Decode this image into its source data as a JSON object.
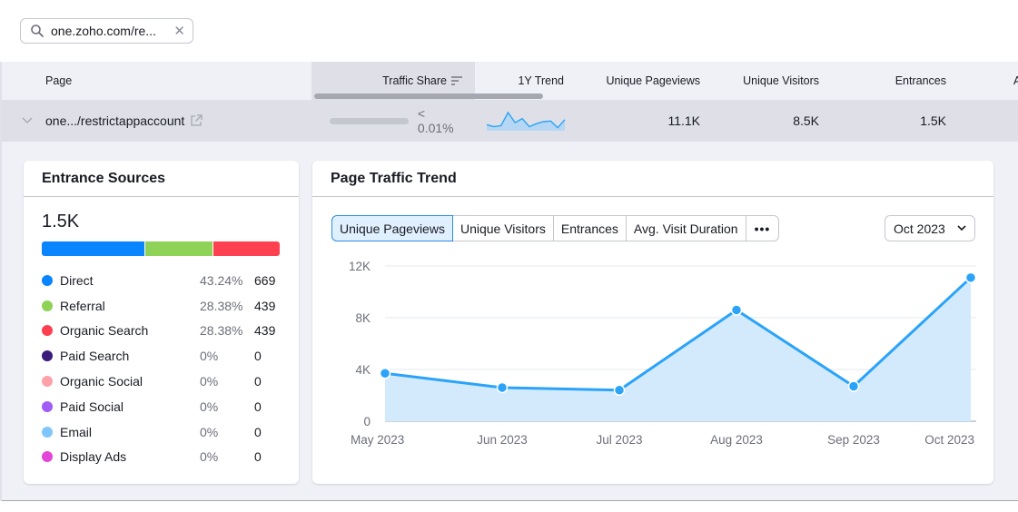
{
  "search": {
    "value": "one.zoho.com/re...",
    "clear_icon": "close-icon",
    "search_icon": "search-icon"
  },
  "table": {
    "columns": {
      "page": "Page",
      "traffic_share": "Traffic Share",
      "trend": "1Y Trend",
      "unique_pageviews": "Unique Pageviews",
      "unique_visitors": "Unique Visitors",
      "entrances": "Entrances",
      "more": "A"
    },
    "row": {
      "page": "one.../restrictappaccount",
      "traffic_share": "< 0.01%",
      "traffic_share_fraction": 0.0001,
      "trend_sparkline": [
        3,
        2,
        2.5,
        9,
        4,
        6,
        2,
        3.5,
        4.5,
        4.8,
        1.5,
        5.5
      ],
      "unique_pageviews": "11.1K",
      "unique_visitors": "8.5K",
      "entrances": "1.5K"
    }
  },
  "entrance_sources": {
    "title": "Entrance Sources",
    "total": "1.5K",
    "items": [
      {
        "name": "Direct",
        "pct": "43.24%",
        "count": "669",
        "color": "#0a84ff",
        "share": 43.24
      },
      {
        "name": "Referral",
        "pct": "28.38%",
        "count": "439",
        "color": "#8fd258",
        "share": 28.38
      },
      {
        "name": "Organic Search",
        "pct": "28.38%",
        "count": "439",
        "color": "#ff4051",
        "share": 28.38
      },
      {
        "name": "Paid Search",
        "pct": "0%",
        "count": "0",
        "color": "#3a1a7a",
        "share": 0
      },
      {
        "name": "Organic Social",
        "pct": "0%",
        "count": "0",
        "color": "#ffa1a8",
        "share": 0
      },
      {
        "name": "Paid Social",
        "pct": "0%",
        "count": "0",
        "color": "#a15cf5",
        "share": 0
      },
      {
        "name": "Email",
        "pct": "0%",
        "count": "0",
        "color": "#7fc6ff",
        "share": 0
      },
      {
        "name": "Display Ads",
        "pct": "0%",
        "count": "0",
        "color": "#e245d8",
        "share": 0
      }
    ]
  },
  "traffic_trend": {
    "title": "Page Traffic Trend",
    "tabs": [
      "Unique Pageviews",
      "Unique Visitors",
      "Entrances",
      "Avg. Visit Duration",
      "•••"
    ],
    "active_tab": "Unique Pageviews",
    "date_selected": "Oct 2023"
  },
  "chart_data": {
    "type": "area",
    "title": "Page Traffic Trend",
    "series": [
      {
        "name": "Unique Pageviews",
        "values": [
          3700,
          2600,
          2400,
          8600,
          2700,
          11100
        ],
        "color": "#2aa3f8"
      }
    ],
    "categories": [
      "May 2023",
      "Jun 2023",
      "Jul 2023",
      "Aug 2023",
      "Sep 2023",
      "Oct 2023"
    ],
    "y_ticks": [
      "0",
      "4K",
      "8K",
      "12K"
    ],
    "y_tick_values": [
      0,
      4000,
      8000,
      12000
    ],
    "ylim": [
      0,
      12000
    ],
    "grid": true,
    "xlabel": "",
    "ylabel": ""
  }
}
